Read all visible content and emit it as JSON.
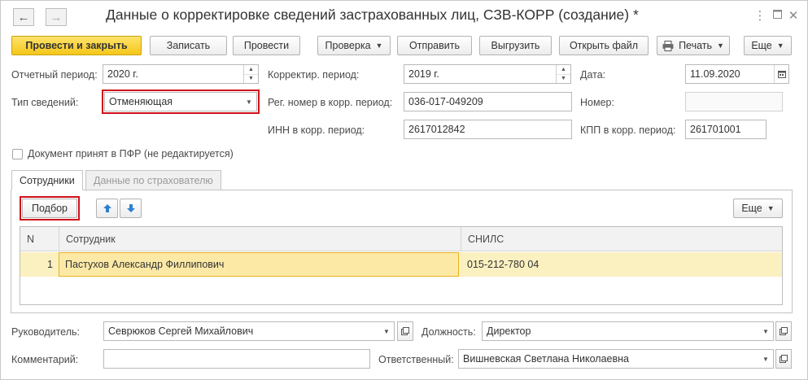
{
  "window": {
    "title": "Данные о корректировке сведений застрахованных лиц, СЗВ-КОРР (создание) *",
    "back_icon": "arrow-left-icon",
    "forward_icon": "arrow-right-icon",
    "menu_icon": "more-vertical-icon",
    "maximize_icon": "maximize-icon",
    "close_icon": "close-icon"
  },
  "toolbar": {
    "post_close": "Провести и закрыть",
    "save": "Записать",
    "post": "Провести",
    "check": "Проверка",
    "send": "Отправить",
    "export": "Выгрузить",
    "open_file": "Открыть файл",
    "print": "Печать",
    "more": "Еще"
  },
  "form": {
    "report_period_label": "Отчетный период:",
    "report_period_value": "2020 г.",
    "corr_period_label": "Корректир. период:",
    "corr_period_value": "2019 г.",
    "date_label": "Дата:",
    "date_value": "11.09.2020",
    "info_type_label": "Тип сведений:",
    "info_type_value": "Отменяющая",
    "reg_number_label": "Рег. номер в корр. период:",
    "reg_number_value": "036-017-049209",
    "number_label": "Номер:",
    "number_value": "",
    "inn_label": "ИНН в корр. период:",
    "inn_value": "2617012842",
    "kpp_label": "КПП в корр. период:",
    "kpp_value": "261701001",
    "accepted_label": "Документ принят в ПФР (не редактируется)",
    "accepted_checked": false
  },
  "tabs": [
    {
      "label": "Сотрудники",
      "active": true
    },
    {
      "label": "Данные по страхователю",
      "active": false
    }
  ],
  "employees": {
    "select_button": "Подбор",
    "more_button": "Еще",
    "columns": {
      "n": "N",
      "employee": "Сотрудник",
      "snils": "СНИЛС"
    },
    "rows": [
      {
        "n": "1",
        "employee": "Пастухов Александр Филлипович",
        "snils": "015-212-780 04"
      }
    ]
  },
  "footer": {
    "head_label": "Руководитель:",
    "head_value": "Севрюков Сергей Михайлович",
    "position_label": "Должность:",
    "position_value": "Директор",
    "comment_label": "Комментарий:",
    "comment_value": "",
    "responsible_label": "Ответственный:",
    "responsible_value": "Вишневская Светлана Николаевна"
  },
  "colors": {
    "primary_button": "#f5c71a",
    "highlight_border": "#d0121b",
    "selected_row": "#fbf0c0",
    "selected_cell_border": "#e6b422"
  }
}
